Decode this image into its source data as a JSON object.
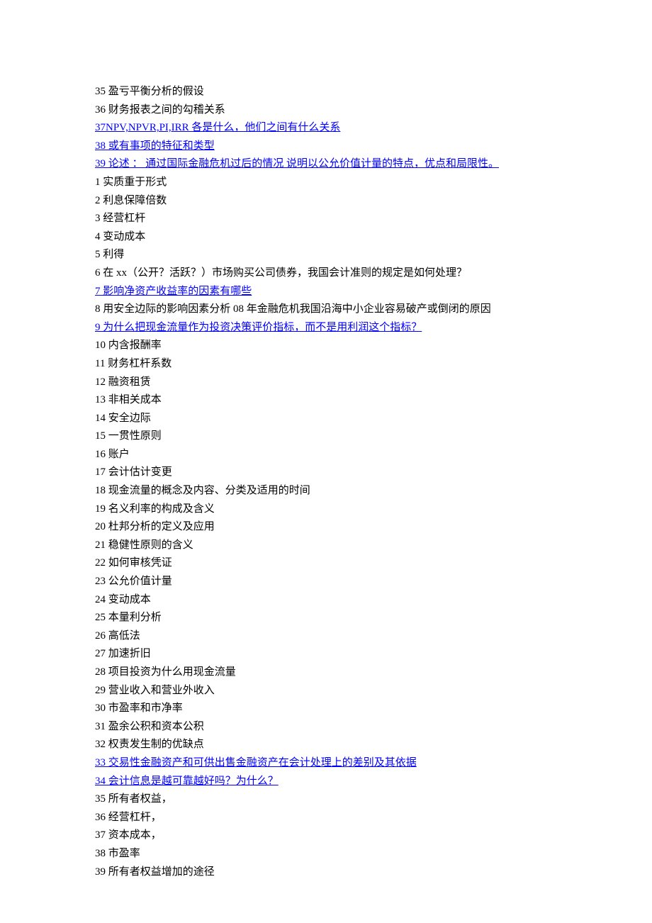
{
  "lines": [
    {
      "text": "35 盈亏平衡分析的假设",
      "link": false
    },
    {
      "text": "36 财务报表之间的勾稽关系",
      "link": false
    },
    {
      "text": "37NPV,NPVR,PI,IRR 各是什么，他们之间有什么关系",
      "link": true
    },
    {
      "text": "38 或有事项的特征和类型",
      "link": true
    },
    {
      "text": "39 论述 ： 通过国际金融危机过后的情况 说明以公允价值计量的特点，优点和局限性。",
      "link": true
    },
    {
      "text": "1 实质重于形式",
      "link": false
    },
    {
      "text": "2 利息保障倍数",
      "link": false
    },
    {
      "text": "3 经营杠杆",
      "link": false
    },
    {
      "text": "4 变动成本",
      "link": false
    },
    {
      "text": "5 利得",
      "link": false
    },
    {
      "text": "6 在 xx（公开？活跃？）市场购买公司债券，我国会计准则的规定是如何处理？",
      "link": false
    },
    {
      "text": "7 影响净资产收益率的因素有哪些",
      "link": true
    },
    {
      "text": "8 用安全边际的影响因素分析 08 年金融危机我国沿海中小企业容易破产或倒闭的原因",
      "link": false
    },
    {
      "text": "9 为什么把现金流量作为投资决策评价指标，而不是用利润这个指标？",
      "link": true
    },
    {
      "text": "10 内含报酬率",
      "link": false
    },
    {
      "text": "11 财务杠杆系数",
      "link": false
    },
    {
      "text": "12 融资租赁",
      "link": false
    },
    {
      "text": "13 非相关成本",
      "link": false
    },
    {
      "text": "14 安全边际",
      "link": false
    },
    {
      "text": "15 一贯性原则",
      "link": false
    },
    {
      "text": "16 账户",
      "link": false
    },
    {
      "text": "17 会计估计变更",
      "link": false
    },
    {
      "text": "18 现金流量的概念及内容、分类及适用的时间",
      "link": false
    },
    {
      "text": "19 名义利率的构成及含义",
      "link": false
    },
    {
      "text": "20 杜邦分析的定义及应用",
      "link": false
    },
    {
      "text": "21 稳健性原则的含义",
      "link": false
    },
    {
      "text": "22 如何审核凭证",
      "link": false
    },
    {
      "text": "23 公允价值计量",
      "link": false
    },
    {
      "text": "24 变动成本",
      "link": false
    },
    {
      "text": "25 本量利分析",
      "link": false
    },
    {
      "text": "26 高低法",
      "link": false
    },
    {
      "text": "27 加速折旧",
      "link": false
    },
    {
      "text": "28 项目投资为什么用现金流量",
      "link": false
    },
    {
      "text": "29 营业收入和营业外收入",
      "link": false
    },
    {
      "text": "30 市盈率和市净率",
      "link": false
    },
    {
      "text": "31 盈余公积和资本公积",
      "link": false
    },
    {
      "text": "32 权责发生制的优缺点",
      "link": false
    },
    {
      "text": "33 交易性金融资产和可供出售金融资产在会计处理上的差别及其依据",
      "link": true
    },
    {
      "text": "34 会计信息是越可靠越好吗？为什么？",
      "link": true
    },
    {
      "text": "35 所有者权益，",
      "link": false
    },
    {
      "text": "36 经营杠杆，",
      "link": false
    },
    {
      "text": "37 资本成本，",
      "link": false
    },
    {
      "text": "38 市盈率",
      "link": false
    },
    {
      "text": "39 所有者权益增加的途径",
      "link": false
    }
  ]
}
